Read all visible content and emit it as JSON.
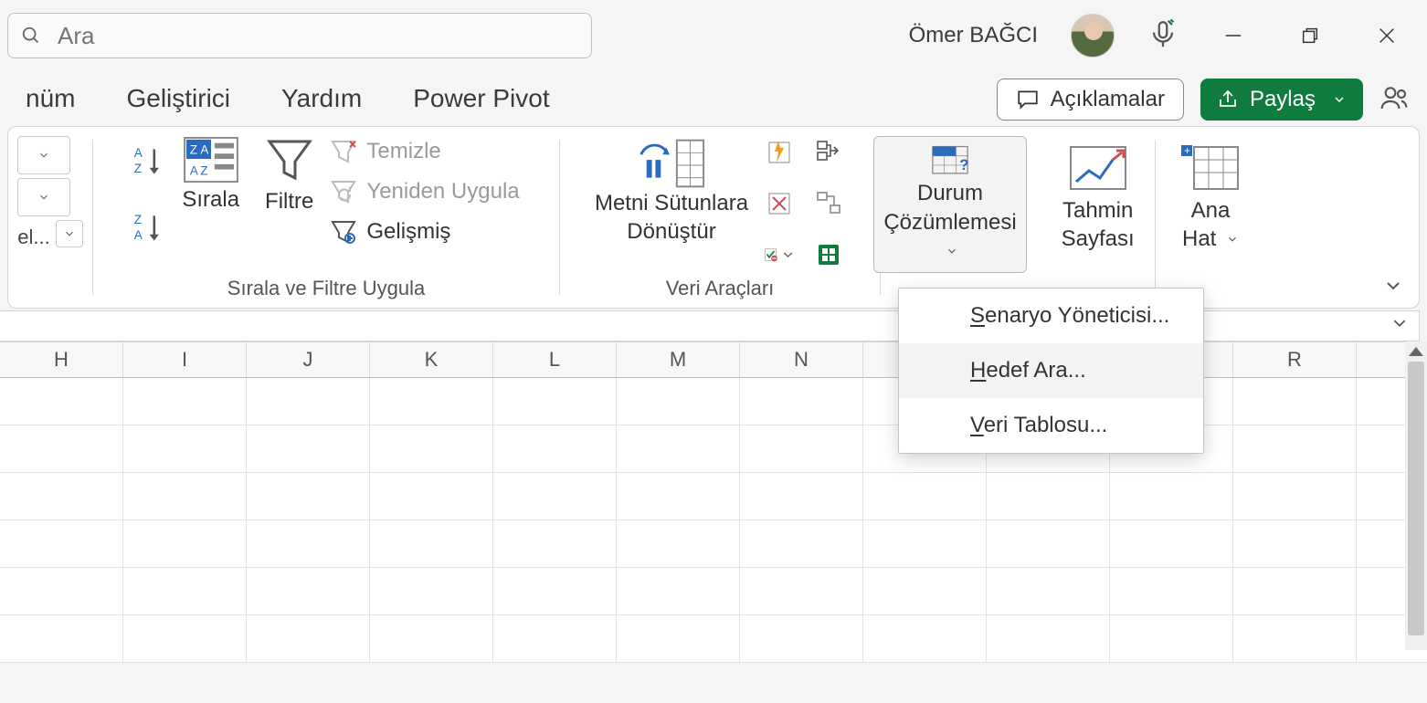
{
  "titlebar": {
    "search_placeholder": "Ara",
    "username": "Ömer BAĞCI"
  },
  "tabs": {
    "t1": "nüm",
    "t2": "Geliştirici",
    "t3": "Yardım",
    "t4": "Power Pivot"
  },
  "actions": {
    "comments": "Açıklamalar",
    "share": "Paylaş"
  },
  "ribbon": {
    "stack_label": "el...",
    "sort_label": "Sırala",
    "filter_label": "Filtre",
    "filter_clear": "Temizle",
    "filter_reapply": "Yeniden Uygula",
    "filter_advanced": "Gelişmiş",
    "group_sortfilter": "Sırala ve Filtre Uygula",
    "text_to_columns_l1": "Metni Sütunlara",
    "text_to_columns_l2": "Dönüştür",
    "group_datatools": "Veri Araçları",
    "whatif_l1": "Durum",
    "whatif_l2": "Çözümlemesi",
    "forecast_l1": "Tahmin",
    "forecast_l2": "Sayfası",
    "outline_l1": "Ana",
    "outline_l2": "Hat"
  },
  "dropdown": {
    "scenario_pre": "S",
    "scenario_rest": "enaryo Yöneticisi...",
    "goal_pre": "H",
    "goal_rest": "edef Ara...",
    "table_pre": "V",
    "table_rest": "eri Tablosu..."
  },
  "columns": [
    "H",
    "I",
    "J",
    "K",
    "L",
    "M",
    "N",
    "",
    "",
    "",
    "R"
  ]
}
